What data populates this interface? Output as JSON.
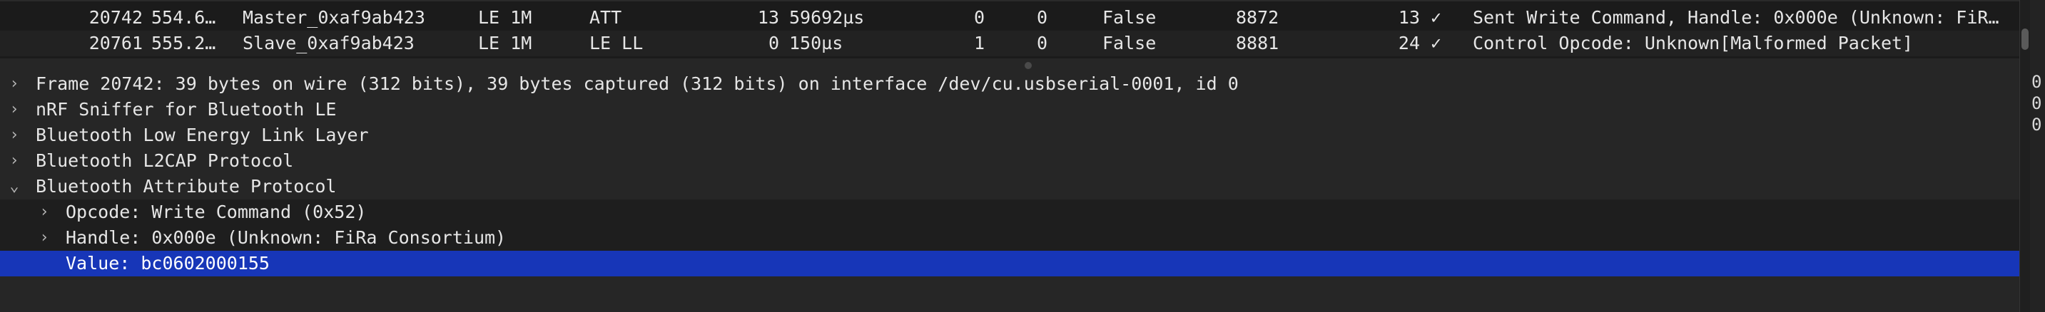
{
  "packet_list": {
    "rows": [
      {
        "no": "20742",
        "time": "554.6…",
        "source": "Master_0xaf9ab423",
        "phy": "LE 1M",
        "protocol": "ATT",
        "length": "13",
        "delta_time": "59692µs",
        "sn": "0",
        "nesn": "0",
        "more_data": "False",
        "event_counter": "8872",
        "packet_length": "13",
        "check": "✓",
        "info": "Sent Write Command, Handle: 0x000e (Unknown: FiR…"
      },
      {
        "no": "20761",
        "time": "555.2…",
        "source": "Slave_0xaf9ab423",
        "phy": "LE 1M",
        "protocol": "LE LL",
        "length": "0",
        "delta_time": "150µs",
        "sn": "1",
        "nesn": "0",
        "more_data": "False",
        "event_counter": "8881",
        "packet_length": "24",
        "check": "✓",
        "info": "Control Opcode: Unknown[Malformed Packet]"
      }
    ]
  },
  "details": {
    "rows": [
      {
        "chevron": "›",
        "chevron_icon": "chevron-right-icon",
        "label": "Frame 20742: 39 bytes on wire (312 bits), 39 bytes captured (312 bits) on interface /dev/cu.usbserial-0001, id 0"
      },
      {
        "chevron": "›",
        "chevron_icon": "chevron-right-icon",
        "label": "nRF Sniffer for Bluetooth LE"
      },
      {
        "chevron": "›",
        "chevron_icon": "chevron-right-icon",
        "label": "Bluetooth Low Energy Link Layer"
      },
      {
        "chevron": "›",
        "chevron_icon": "chevron-right-icon",
        "label": "Bluetooth L2CAP Protocol"
      },
      {
        "chevron": "⌄",
        "chevron_icon": "chevron-down-icon",
        "label": "Bluetooth Attribute Protocol"
      },
      {
        "chevron": "›",
        "chevron_icon": "chevron-right-icon",
        "label": "Opcode: Write Command (0x52)"
      },
      {
        "chevron": "›",
        "chevron_icon": "chevron-right-icon",
        "label": "Handle: 0x000e (Unknown: FiRa Consortium)"
      },
      {
        "label": "Value: bc0602000155",
        "selected": true
      }
    ]
  },
  "bytes_pane": {
    "visible_chars": [
      "0",
      "0",
      "0"
    ]
  },
  "colors": {
    "selection": "#1736b8",
    "background": "#1e1e1e",
    "text": "#e6e6e6"
  }
}
